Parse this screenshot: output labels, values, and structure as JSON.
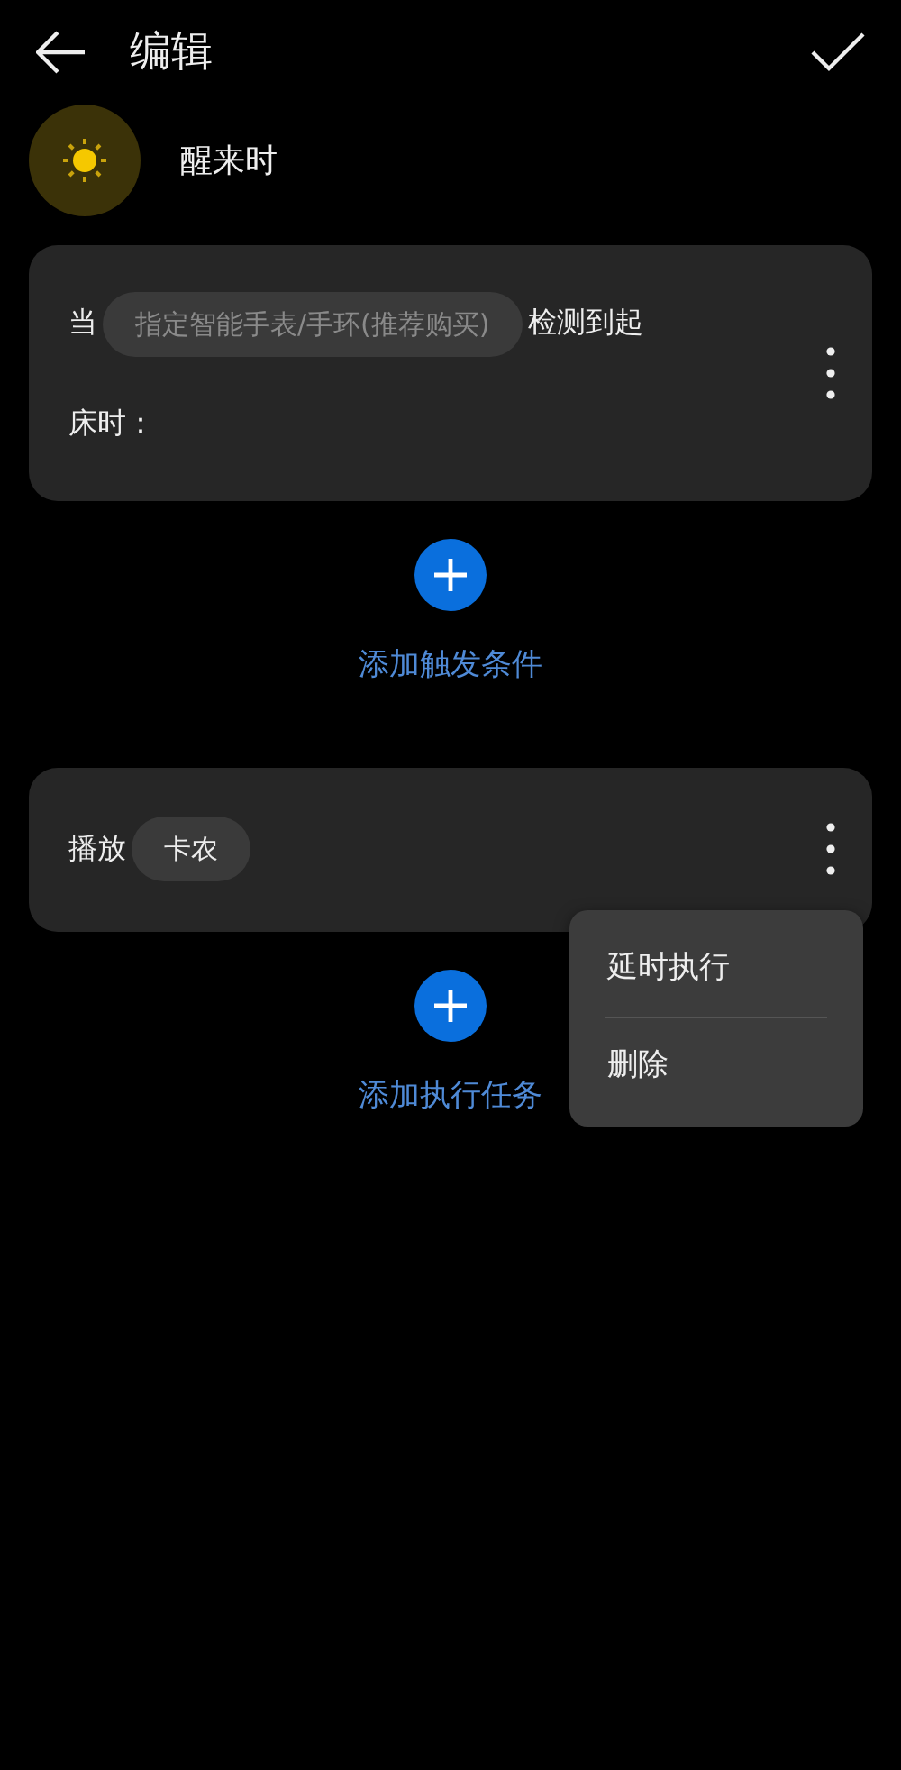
{
  "header": {
    "title": "编辑"
  },
  "scene": {
    "name": "醒来时"
  },
  "trigger": {
    "prefix": "当",
    "chip": {
      "placeholder": "指定智能手表/手环(推荐购买)"
    },
    "suffix": "检测到起床时："
  },
  "add_trigger": {
    "label": "添加触发条件"
  },
  "task": {
    "prefix": "播放",
    "chip": {
      "value": "卡农"
    }
  },
  "add_task": {
    "label": "添加执行任务"
  },
  "menu": {
    "items": [
      {
        "label": "延时执行"
      },
      {
        "label": "删除"
      }
    ]
  }
}
